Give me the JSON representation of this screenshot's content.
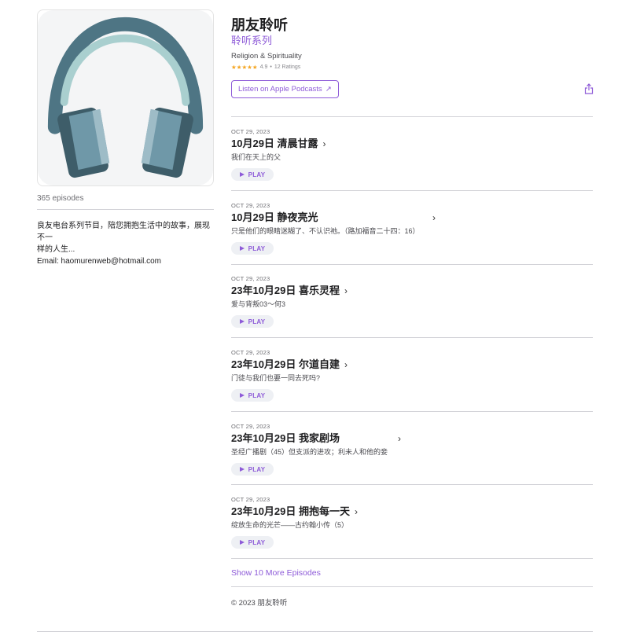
{
  "podcast": {
    "title": "朋友聆听",
    "subtitle": "聆听系列",
    "category": "Religion & Spirituality",
    "stars": "★★★★★",
    "rating": "4.9",
    "rating_sep": "•",
    "rating_count": "12 Ratings",
    "listen_button": "Listen on Apple Podcasts",
    "listen_arrow": "↗"
  },
  "sidebar": {
    "episode_count": "365 episodes",
    "description_line1": "良友电台系列节目，陪您拥抱生活中的故事，展现不一",
    "description_line2": "样的人生...",
    "description_line3": "Email: haomurenweb@hotmail.com"
  },
  "episodes": [
    {
      "date": "OCT 29, 2023",
      "title": "10月29日 清晨甘露",
      "description": "我们在天上的父",
      "play": "PLAY"
    },
    {
      "date": "OCT 29, 2023",
      "title": "10月29日 静夜亮光",
      "description": "只是他们的眼睛迷糊了、不认识祂。（路加福音二十四：16）",
      "play": "PLAY"
    },
    {
      "date": "OCT 29, 2023",
      "title": "23年10月29日 喜乐灵程",
      "description": "爱与背叛03～何3",
      "play": "PLAY"
    },
    {
      "date": "OCT 29, 2023",
      "title": "23年10月29日 尔道自建",
      "description": "门徒与我们也要一同去死吗?",
      "play": "PLAY"
    },
    {
      "date": "OCT 29, 2023",
      "title": "23年10月29日 我家剧场",
      "description": "圣经广播剧（45）但支派的进攻；利未人和他的妾",
      "play": "PLAY"
    },
    {
      "date": "OCT 29, 2023",
      "title": "23年10月29日 拥抱每一天",
      "description": "绽放生命的光芒——古约翰小传（5）",
      "play": "PLAY"
    }
  ],
  "chevron": "›",
  "more_episodes": "Show 10 More Episodes",
  "copyright": "© 2023 朋友聆听",
  "colors": {
    "accent": "#8e5bd8",
    "star": "#f5a623",
    "headphone_band": "#4e7584",
    "headphone_inner": "#a9cfcf",
    "cup": "#6f98a8"
  },
  "icons": {
    "artwork": "headphones-icon",
    "share": "share-icon",
    "play": "play-icon",
    "chevron": "chevron-right-icon"
  }
}
